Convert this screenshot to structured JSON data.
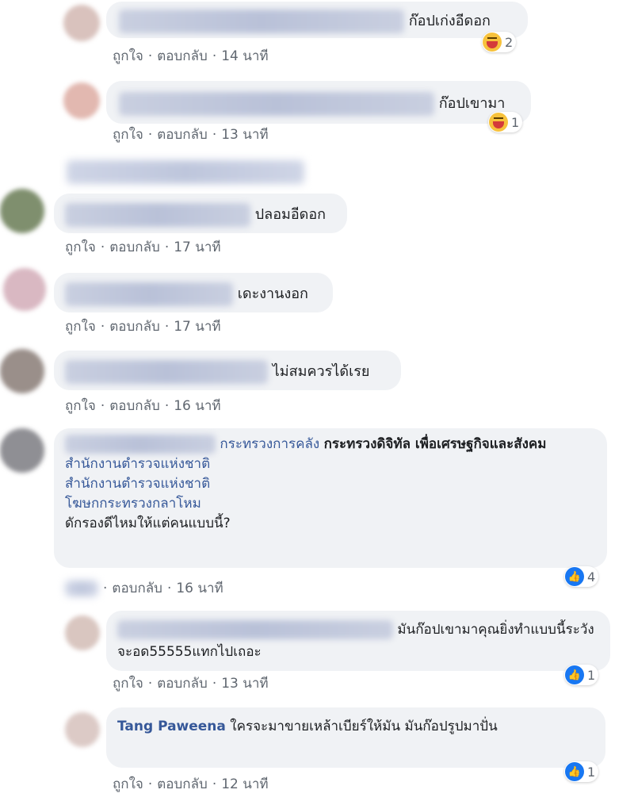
{
  "comments": [
    {
      "text": "ก๊อปเก่งอีดอก",
      "reaction": "2"
    },
    {
      "text": "ก๊อปเขามา",
      "reaction": "1"
    },
    {
      "text": "ปลอมอีดอก"
    },
    {
      "text": "เดะงานงอก"
    },
    {
      "text": "ไม่สมควรได้เรย"
    },
    {
      "link1": "กระทรวงการคลัง",
      "bold1": "กระทรวงดิจิทัล เพื่อเศรษฐกิจและสังคม",
      "link2": "สำนักงานตำรวจแห่งชาติ",
      "link3": "สำนักงานตำรวจแห่งชาติ",
      "link4": "โฆษกกระทรวงกลาโหม",
      "tail": "ดักรองดีไหมให้แต่คนแบบนี้?",
      "reaction": "4"
    },
    {
      "text": "มันก๊อปเขามาคุณยิ่งทำแบบนี้ระวังจะอด55555แทกไปเถอะ",
      "reaction": "1"
    },
    {
      "name": "Tang Paweena",
      "text": "ใครจะมาขายเหล้าเบียร์ให้มัน มันก๊อปรูปมาปั่น",
      "reaction": "1"
    }
  ],
  "meta": {
    "like": "ถูกใจ",
    "reply": "ตอบกลับ",
    "sep": "·",
    "t14": "14 นาที",
    "t13": "13 นาที",
    "t17": "17 นาที",
    "t16": "16 นาที",
    "t12": "12 นาที"
  },
  "colors": {
    "bubble": "#f0f2f5",
    "link": "#365899",
    "meta": "#606770"
  }
}
